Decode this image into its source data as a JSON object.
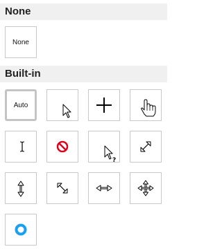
{
  "sections": {
    "none": {
      "title": "None"
    },
    "builtin": {
      "title": "Built-in"
    }
  },
  "tiles": {
    "none": {
      "label": "None",
      "icon": "none-label"
    },
    "auto": {
      "label": "Auto",
      "icon": "auto-label",
      "selected": true
    },
    "default": {
      "icon": "arrow-pointer-icon"
    },
    "crosshair": {
      "icon": "crosshair-icon"
    },
    "pointer": {
      "icon": "hand-pointer-icon"
    },
    "text": {
      "icon": "text-ibeam-icon"
    },
    "not_allowed": {
      "icon": "not-allowed-icon",
      "color": "#e0001b"
    },
    "help": {
      "icon": "help-arrow-icon"
    },
    "nesw_resize": {
      "icon": "nesw-resize-icon"
    },
    "ns_resize": {
      "icon": "ns-resize-icon"
    },
    "nwse_resize": {
      "icon": "nwse-resize-icon"
    },
    "ew_resize": {
      "icon": "ew-resize-icon"
    },
    "move": {
      "icon": "move-icon"
    },
    "progress": {
      "icon": "progress-ring-icon",
      "color": "#1aa0f0"
    }
  }
}
